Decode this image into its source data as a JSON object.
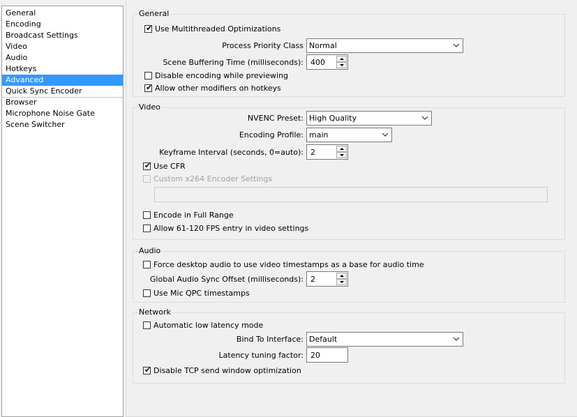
{
  "sidebar": {
    "items": [
      "General",
      "Encoding",
      "Broadcast Settings",
      "Video",
      "Audio",
      "Hotkeys",
      "Advanced",
      "Quick Sync Encoder",
      "Browser",
      "Microphone Noise Gate",
      "Scene Switcher"
    ],
    "selected": "Advanced",
    "selected_color": "#3399ff"
  },
  "general": {
    "title": "General",
    "multithreaded_label": "Use Multithreaded Optimizations",
    "multithreaded_checked": true,
    "priority_label": "Process Priority Class",
    "priority_value": "Normal",
    "buffering_label": "Scene Buffering Time (milliseconds):",
    "buffering_value": "400",
    "disable_preview_label": "Disable encoding while previewing",
    "disable_preview_checked": false,
    "modifiers_label": "Allow other modifiers on hotkeys",
    "modifiers_checked": true
  },
  "video": {
    "title": "Video",
    "nvenc_label": "NVENC Preset:",
    "nvenc_value": "High Quality",
    "profile_label": "Encoding Profile:",
    "profile_value": "main",
    "keyframe_label": "Keyframe Interval (seconds, 0=auto):",
    "keyframe_value": "2",
    "cfr_label": "Use CFR",
    "cfr_checked": true,
    "x264_label": "Custom x264 Encoder Settings",
    "x264_checked": false,
    "x264_value": "",
    "full_range_label": "Encode in Full Range",
    "full_range_checked": false,
    "fps_label": "Allow 61-120 FPS entry in video settings",
    "fps_checked": false
  },
  "audio": {
    "title": "Audio",
    "force_label": "Force desktop audio to use video timestamps as a base for audio time",
    "force_checked": false,
    "sync_label": "Global Audio Sync Offset (milliseconds):",
    "sync_value": "2",
    "qpc_label": "Use Mic QPC timestamps",
    "qpc_checked": false
  },
  "network": {
    "title": "Network",
    "low_latency_label": "Automatic low latency mode",
    "low_latency_checked": false,
    "bind_label": "Bind To Interface:",
    "bind_value": "Default",
    "latency_label": "Latency tuning factor:",
    "latency_value": "20",
    "tcp_label": "Disable TCP send window optimization",
    "tcp_checked": true
  }
}
